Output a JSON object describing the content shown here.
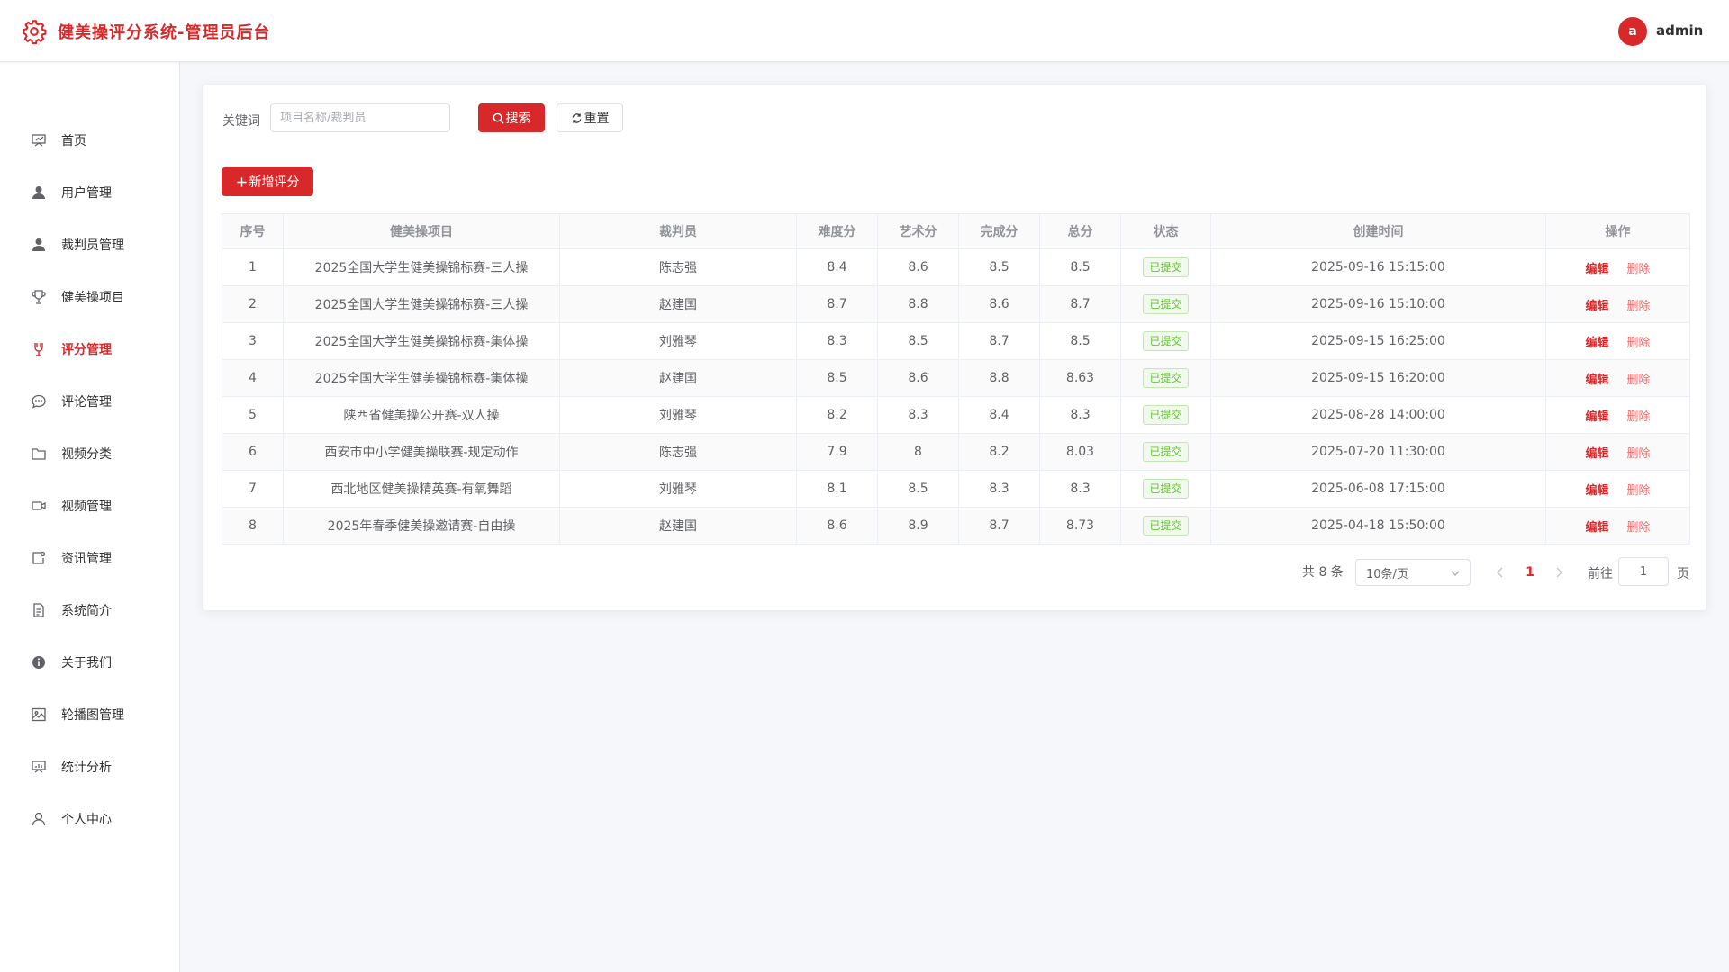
{
  "header": {
    "title": "健美操评分系统-管理员后台",
    "avatar_letter": "a",
    "username": "admin",
    "brand_color": "#d8282a"
  },
  "sidebar": {
    "items": [
      {
        "label": "首页",
        "icon": "dashboard-icon"
      },
      {
        "label": "用户管理",
        "icon": "user-icon"
      },
      {
        "label": "裁判员管理",
        "icon": "user-icon"
      },
      {
        "label": "健美操项目",
        "icon": "trophy-icon"
      },
      {
        "label": "评分管理",
        "icon": "score-icon",
        "active": true
      },
      {
        "label": "评论管理",
        "icon": "chat-icon"
      },
      {
        "label": "视频分类",
        "icon": "folder-icon"
      },
      {
        "label": "视频管理",
        "icon": "video-icon"
      },
      {
        "label": "资讯管理",
        "icon": "news-icon"
      },
      {
        "label": "系统简介",
        "icon": "document-icon"
      },
      {
        "label": "关于我们",
        "icon": "info-icon"
      },
      {
        "label": "轮播图管理",
        "icon": "picture-icon"
      },
      {
        "label": "统计分析",
        "icon": "chart-icon"
      },
      {
        "label": "个人中心",
        "icon": "person-icon"
      }
    ]
  },
  "search": {
    "label": "关键词",
    "placeholder": "项目名称/裁判员",
    "value": "",
    "search_button": "搜索",
    "reset_button": "重置",
    "add_button": "新增评分"
  },
  "table": {
    "columns": [
      "序号",
      "健美操项目",
      "裁判员",
      "难度分",
      "艺术分",
      "完成分",
      "总分",
      "状态",
      "创建时间",
      "操作"
    ],
    "rows": [
      {
        "no": "1",
        "project": "2025全国大学生健美操锦标赛-三人操",
        "judge": "陈志强",
        "difficulty": "8.4",
        "artistry": "8.6",
        "execution": "8.5",
        "total": "8.5",
        "status": "已提交",
        "created": "2025-09-16 15:15:00"
      },
      {
        "no": "2",
        "project": "2025全国大学生健美操锦标赛-三人操",
        "judge": "赵建国",
        "difficulty": "8.7",
        "artistry": "8.8",
        "execution": "8.6",
        "total": "8.7",
        "status": "已提交",
        "created": "2025-09-16 15:10:00"
      },
      {
        "no": "3",
        "project": "2025全国大学生健美操锦标赛-集体操",
        "judge": "刘雅琴",
        "difficulty": "8.3",
        "artistry": "8.5",
        "execution": "8.7",
        "total": "8.5",
        "status": "已提交",
        "created": "2025-09-15 16:25:00"
      },
      {
        "no": "4",
        "project": "2025全国大学生健美操锦标赛-集体操",
        "judge": "赵建国",
        "difficulty": "8.5",
        "artistry": "8.6",
        "execution": "8.8",
        "total": "8.63",
        "status": "已提交",
        "created": "2025-09-15 16:20:00"
      },
      {
        "no": "5",
        "project": "陕西省健美操公开赛-双人操",
        "judge": "刘雅琴",
        "difficulty": "8.2",
        "artistry": "8.3",
        "execution": "8.4",
        "total": "8.3",
        "status": "已提交",
        "created": "2025-08-28 14:00:00"
      },
      {
        "no": "6",
        "project": "西安市中小学健美操联赛-规定动作",
        "judge": "陈志强",
        "difficulty": "7.9",
        "artistry": "8",
        "execution": "8.2",
        "total": "8.03",
        "status": "已提交",
        "created": "2025-07-20 11:30:00"
      },
      {
        "no": "7",
        "project": "西北地区健美操精英赛-有氧舞蹈",
        "judge": "刘雅琴",
        "difficulty": "8.1",
        "artistry": "8.5",
        "execution": "8.3",
        "total": "8.3",
        "status": "已提交",
        "created": "2025-06-08 17:15:00"
      },
      {
        "no": "8",
        "project": "2025年春季健美操邀请赛-自由操",
        "judge": "赵建国",
        "difficulty": "8.6",
        "artistry": "8.9",
        "execution": "8.7",
        "total": "8.73",
        "status": "已提交",
        "created": "2025-04-18 15:50:00"
      }
    ],
    "edit_label": "编辑",
    "delete_label": "删除"
  },
  "pagination": {
    "total_text": "共 8 条",
    "page_size": "10条/页",
    "current_page": "1",
    "goto_label": "前往",
    "goto_value": "1",
    "page_suffix": "页"
  }
}
